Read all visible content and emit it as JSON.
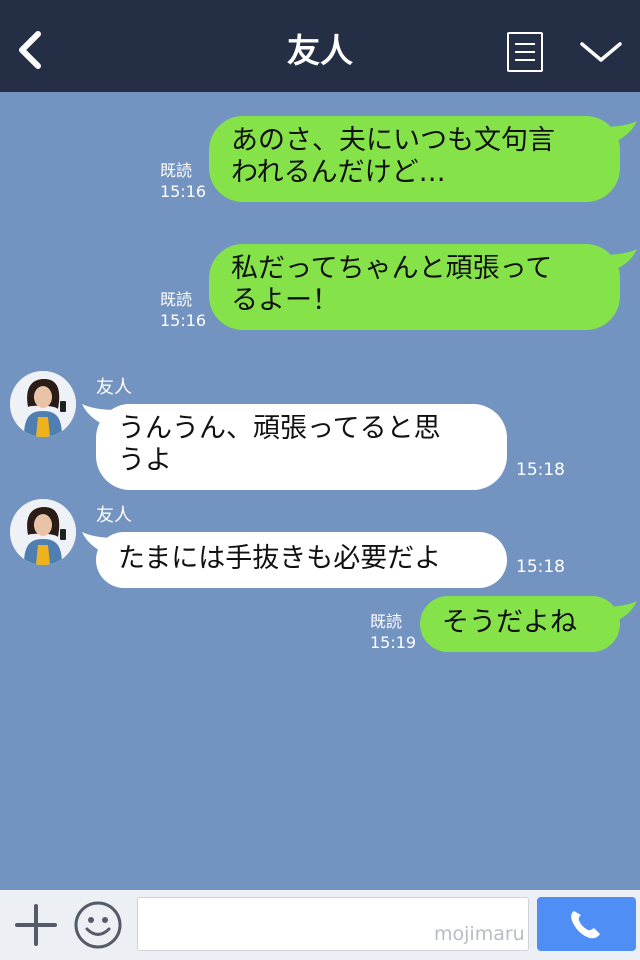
{
  "header": {
    "title": "友人",
    "back_icon": "chevron-left-icon",
    "note_icon": "note-icon",
    "menu_icon": "chevron-down-icon"
  },
  "messages": [
    {
      "side": "right",
      "text_line1": "あのさ、夫にいつも文句言",
      "text_line2": "われるんだけど…",
      "read": "既読",
      "time": "15:16"
    },
    {
      "side": "right",
      "text_line1": "私だってちゃんと頑張って",
      "text_line2": "るよー！",
      "read": "既読",
      "time": "15:16"
    },
    {
      "side": "left",
      "sender": "友人",
      "text_line1": "うんうん、頑張ってると思",
      "text_line2": "うよ",
      "time": "15:18"
    },
    {
      "side": "left",
      "sender": "友人",
      "text": "たまには手抜きも必要だよ",
      "time": "15:18"
    },
    {
      "side": "right",
      "text": "そうだよね",
      "read": "既読",
      "time": "15:19"
    }
  ],
  "input": {
    "placeholder": "",
    "watermark": "mojimaru",
    "plus_icon": "plus-icon",
    "emoji_icon": "smiley-icon",
    "call_icon": "phone-icon"
  },
  "colors": {
    "header_bg": "#242e45",
    "chat_bg": "#7393c1",
    "sent_bubble": "#85e249",
    "received_bubble": "#ffffff",
    "call_button": "#4f8ef5"
  }
}
